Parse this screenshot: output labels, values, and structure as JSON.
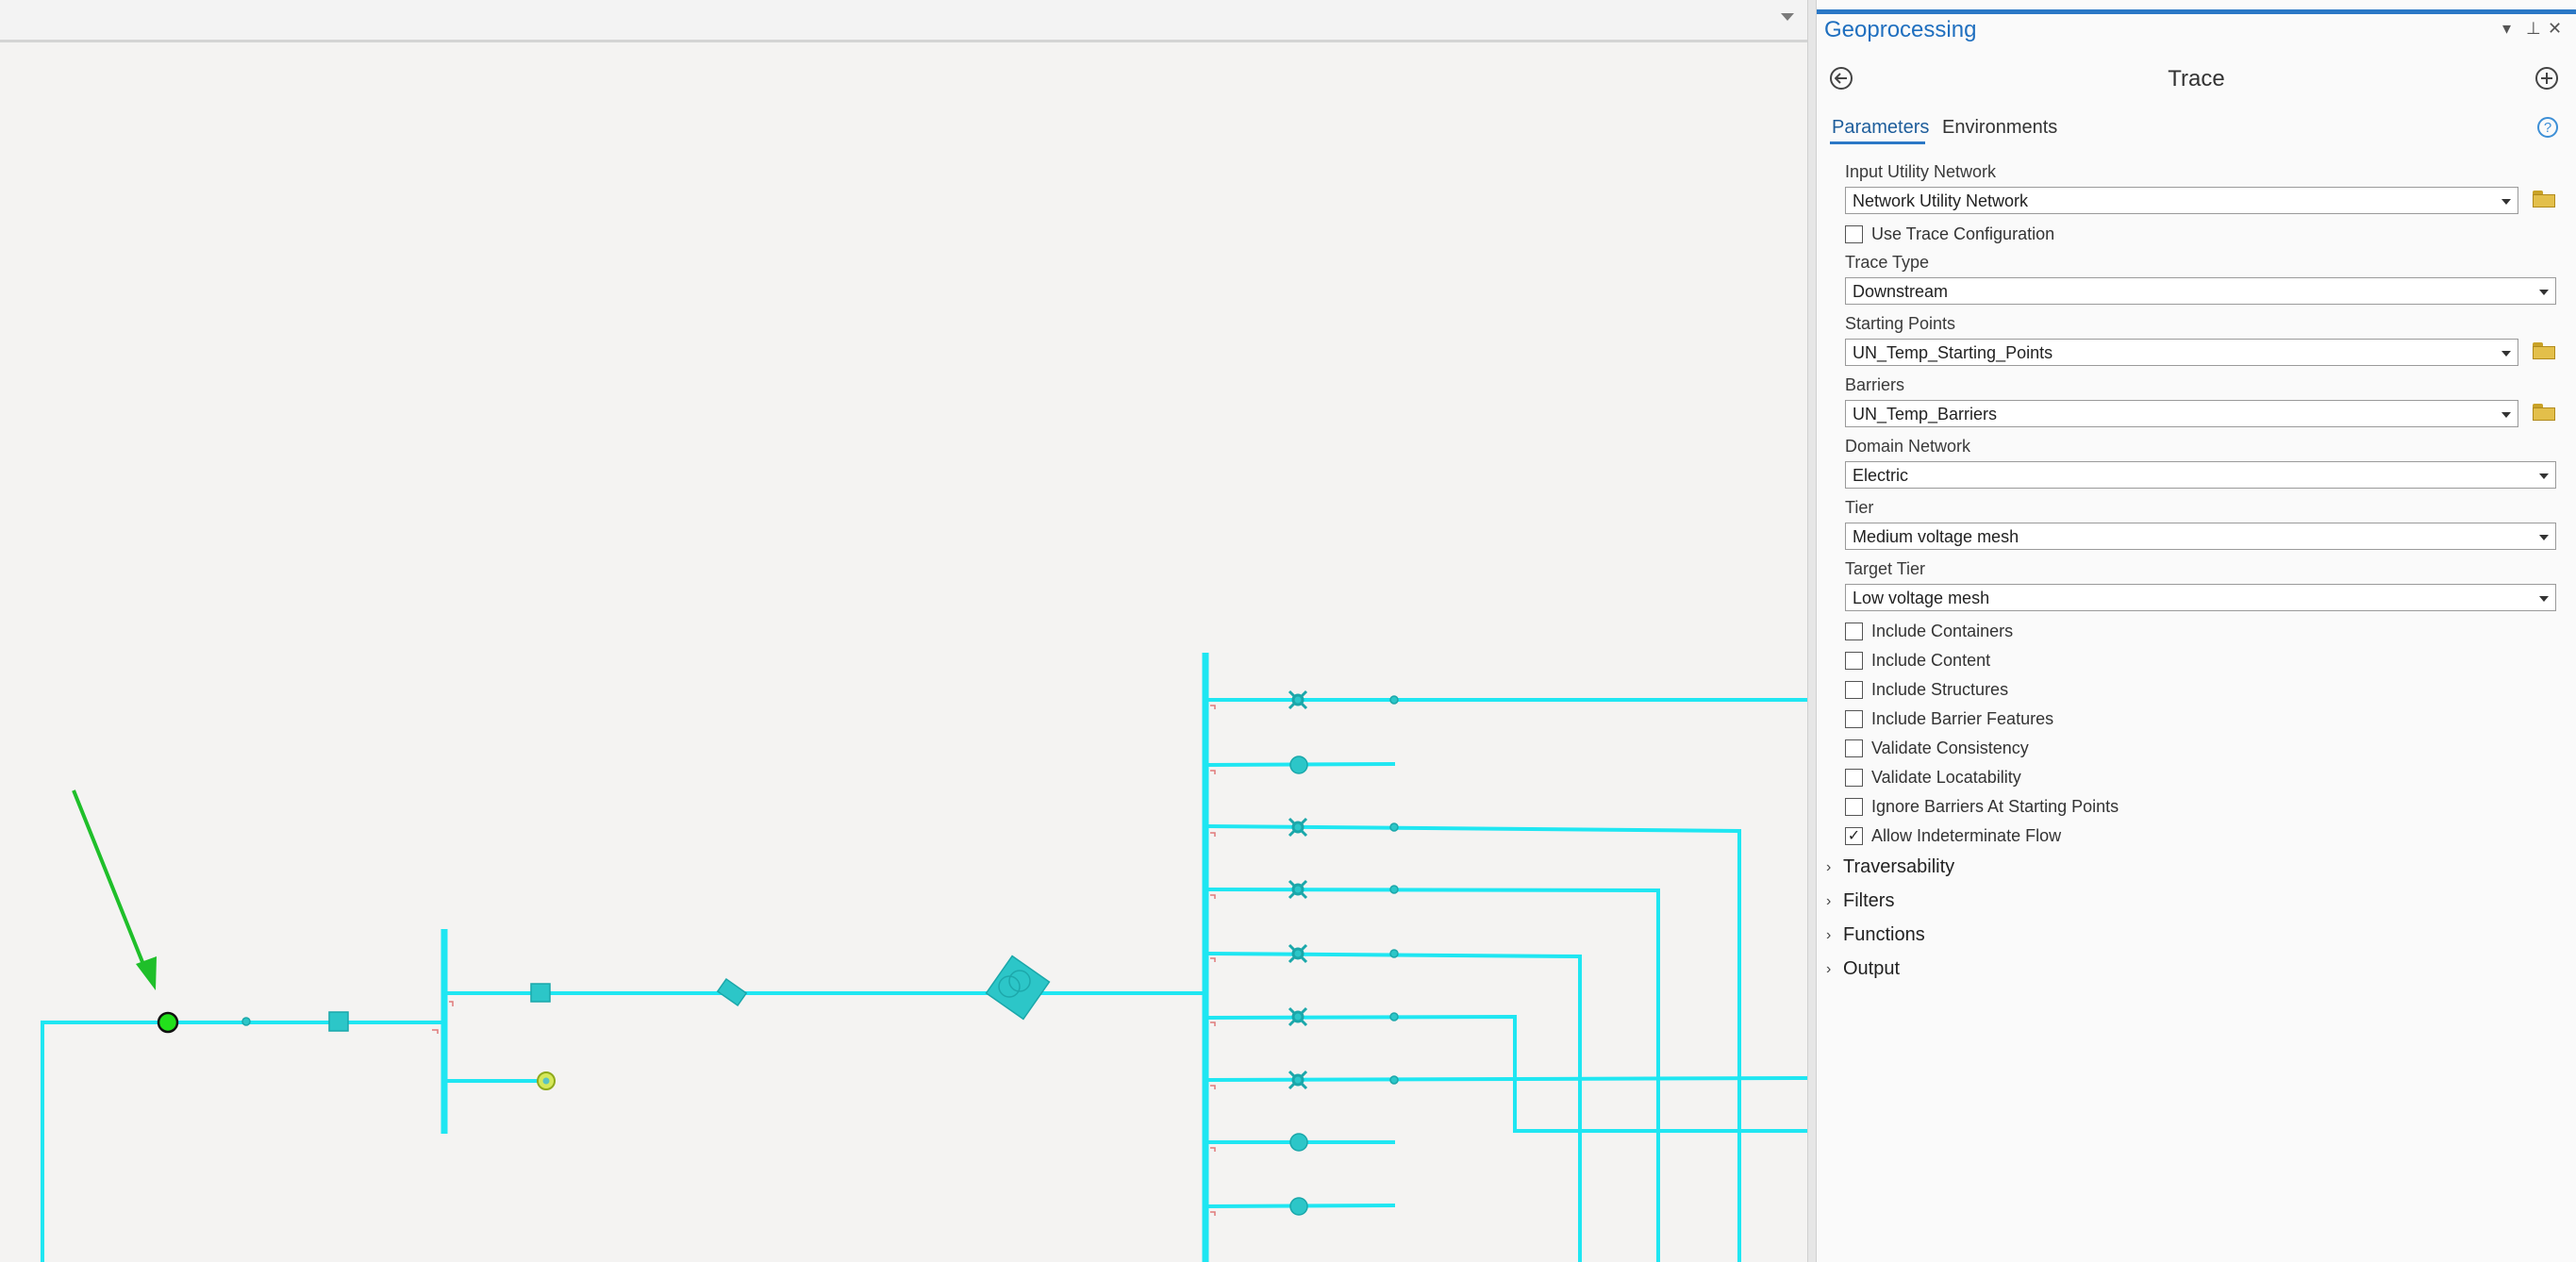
{
  "pane": {
    "title": "Geoprocessing",
    "controls": {
      "dropdown": "▾",
      "pin": "⊥",
      "close": "✕"
    },
    "tool_name": "Trace",
    "tabs": [
      "Parameters",
      "Environments"
    ]
  },
  "params": {
    "input_utility_network": {
      "label": "Input Utility Network",
      "value": "Network Utility Network"
    },
    "use_trace_config": {
      "label": "Use Trace Configuration",
      "checked": false
    },
    "trace_type": {
      "label": "Trace Type",
      "value": "Downstream"
    },
    "starting_points": {
      "label": "Starting Points",
      "value": "UN_Temp_Starting_Points"
    },
    "barriers": {
      "label": "Barriers",
      "value": "UN_Temp_Barriers"
    },
    "domain_network": {
      "label": "Domain Network",
      "value": "Electric"
    },
    "tier": {
      "label": "Tier",
      "value": "Medium voltage mesh"
    },
    "target_tier": {
      "label": "Target Tier",
      "value": "Low voltage mesh"
    },
    "checkboxes": [
      {
        "label": "Include Containers",
        "checked": false
      },
      {
        "label": "Include Content",
        "checked": false
      },
      {
        "label": "Include Structures",
        "checked": false
      },
      {
        "label": "Include Barrier Features",
        "checked": false
      },
      {
        "label": "Validate Consistency",
        "checked": false
      },
      {
        "label": "Validate Locatability",
        "checked": false
      },
      {
        "label": "Ignore Barriers At Starting Points",
        "checked": false
      },
      {
        "label": "Allow Indeterminate Flow",
        "checked": true
      }
    ]
  },
  "sections": [
    "Traversability",
    "Filters",
    "Functions",
    "Output"
  ],
  "icons": {
    "back": "back-arrow-icon",
    "add": "add-icon",
    "help": "help-icon",
    "folder": "folder-icon",
    "chevron": "chevron-right-icon"
  },
  "colors": {
    "accent": "#2b78c6",
    "network_line": "#1fe6f2",
    "network_device": "#2cc6c8",
    "start_point": "#22e01b",
    "arrow": "#1fbf2a",
    "folder": "#e3bf4a"
  }
}
